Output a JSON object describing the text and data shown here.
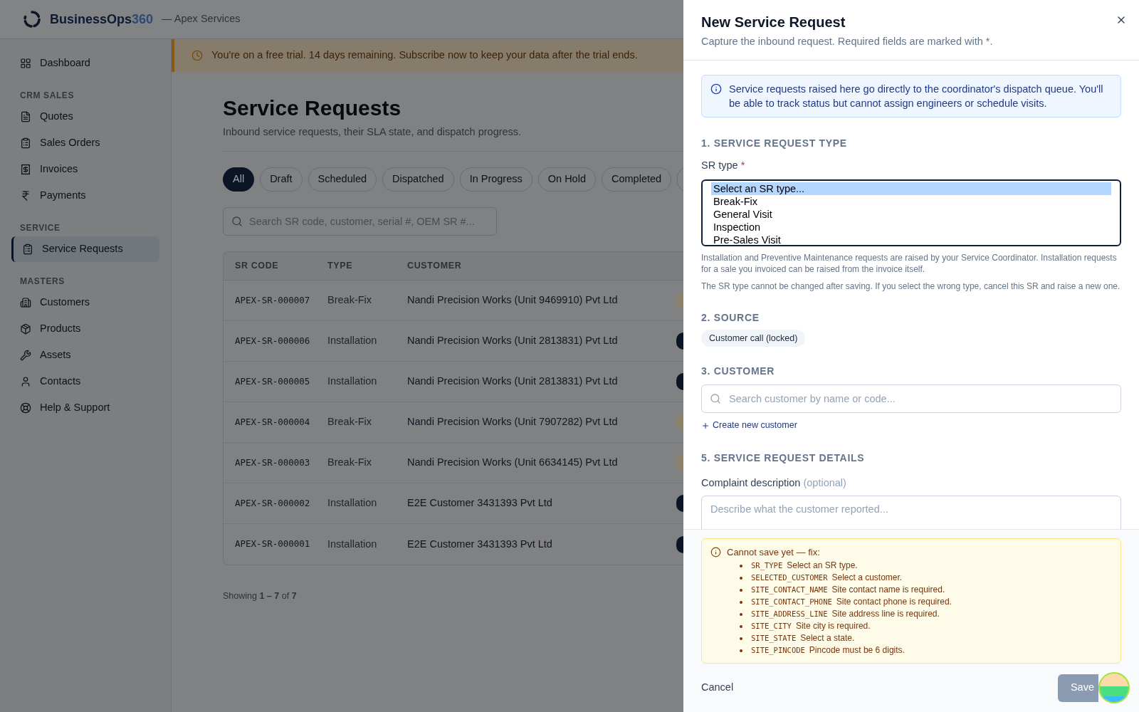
{
  "app": {
    "brand": "BusinessOps",
    "brand_suffix": "360",
    "org": "— Apex Services"
  },
  "sidebar": {
    "groups": [
      {
        "items": [
          {
            "label": "Dashboard",
            "selected": false
          }
        ]
      },
      {
        "heading": "CRM SALES",
        "items": [
          {
            "label": "Quotes",
            "selected": false
          },
          {
            "label": "Sales Orders",
            "selected": false
          },
          {
            "label": "Invoices",
            "selected": false
          },
          {
            "label": "Payments",
            "selected": false
          }
        ]
      },
      {
        "heading": "SERVICE",
        "items": [
          {
            "label": "Service Requests",
            "selected": true
          }
        ]
      },
      {
        "heading": "MASTERS",
        "items": [
          {
            "label": "Customers",
            "selected": false
          },
          {
            "label": "Products",
            "selected": false
          },
          {
            "label": "Assets",
            "selected": false
          },
          {
            "label": "Contacts",
            "selected": false
          },
          {
            "label": "Help & Support",
            "selected": false
          }
        ]
      }
    ]
  },
  "trial_banner": "You're on a free trial. 14 days remaining. Subscribe now to keep your data after the trial ends.",
  "page": {
    "title": "Service Requests",
    "subtitle": "Inbound service requests, their SLA state, and dispatch progress.",
    "filters": [
      {
        "label": "All",
        "selected": true
      },
      {
        "label": "Draft",
        "selected": false
      },
      {
        "label": "Scheduled",
        "selected": false
      },
      {
        "label": "Dispatched",
        "selected": false
      },
      {
        "label": "In Progress",
        "selected": false
      },
      {
        "label": "On Hold",
        "selected": false
      },
      {
        "label": "Completed",
        "selected": false
      },
      {
        "selected": false
      }
    ],
    "search_placeholder": "Search SR code, customer, serial #, OEM SR #...",
    "table": {
      "columns": [
        "SR CODE",
        "TYPE",
        "CUSTOMER"
      ],
      "rows": [
        {
          "code": "APEX-SR-000007",
          "type": "Break-Fix",
          "customer": "Nandi Precision Works (Unit 9469910) Pvt Ltd",
          "color": "#8a826a"
        },
        {
          "code": "APEX-SR-000006",
          "type": "Installation",
          "customer": "Nandi Precision Works (Unit 2813831) Pvt Ltd",
          "color": "#0b1526"
        },
        {
          "code": "APEX-SR-000005",
          "type": "Installation",
          "customer": "Nandi Precision Works (Unit 2813831) Pvt Ltd",
          "color": "#0b1526"
        },
        {
          "code": "APEX-SR-000004",
          "type": "Break-Fix",
          "customer": "Nandi Precision Works (Unit 7907282) Pvt Ltd",
          "color": "#8a826a"
        },
        {
          "code": "APEX-SR-000003",
          "type": "Break-Fix",
          "customer": "Nandi Precision Works (Unit 6634145) Pvt Ltd",
          "color": "#8a826a"
        },
        {
          "code": "APEX-SR-000002",
          "type": "Installation",
          "customer": "E2E Customer 3431393 Pvt Ltd",
          "color": "#0b1526"
        },
        {
          "code": "APEX-SR-000001",
          "type": "Installation",
          "customer": "E2E Customer 3431393 Pvt Ltd",
          "color": "#0b1526"
        }
      ]
    },
    "showing": "Showing **1 – 7** of **7**"
  },
  "drawer": {
    "title": "New Service Request",
    "subtitle": "Capture the inbound request. Required fields are marked with *.",
    "info": "Service requests raised here go directly to the coordinator's dispatch queue. You'll be able to track status but cannot assign engineers or schedule visits.",
    "sections": [
      {
        "heading": "1. SERVICE REQUEST TYPE",
        "label": "SR type",
        "required_mark": "*",
        "options": [
          {
            "label": "Select an SR type...",
            "selected": true
          },
          {
            "label": "Break-Fix",
            "selected": false
          },
          {
            "label": "General Visit",
            "selected": false
          },
          {
            "label": "Inspection",
            "selected": false
          },
          {
            "label": "Pre-Sales Visit",
            "selected": false
          }
        ],
        "notes": [
          "Installation and Preventive Maintenance requests are raised by your Service Coordinator. Installation requests for a sale you invoiced can be raised from the invoice itself.",
          "The SR type cannot be changed after saving. If you select the wrong type, cancel this SR and raise a new one."
        ]
      },
      {
        "heading": "2. SOURCE",
        "chip": "Customer call (locked)"
      },
      {
        "heading": "3. CUSTOMER",
        "placeholder": "Search customer by name or code...",
        "link": "Create new customer"
      },
      {
        "heading": "5. SERVICE REQUEST DETAILS",
        "label": "Complaint description",
        "hint": "(optional)",
        "placeholder": "Describe what the customer reported..."
      }
    ],
    "errors": {
      "title": "Cannot save yet — fix:",
      "items": [
        {
          "code": "SR_TYPE",
          "text": "Select an SR type."
        },
        {
          "code": "SELECTED_CUSTOMER",
          "text": "Select a customer."
        },
        {
          "code": "SITE_CONTACT_NAME",
          "text": "Site contact name is required."
        },
        {
          "code": "SITE_CONTACT_PHONE",
          "text": "Site contact phone is required."
        },
        {
          "code": "SITE_ADDRESS_LINE",
          "text": "Site address line is required."
        },
        {
          "code": "SITE_CITY",
          "text": "Site city is required."
        },
        {
          "code": "SITE_STATE",
          "text": "Select a state."
        },
        {
          "code": "SITE_PINCODE",
          "text": "Pincode must be 6 digits."
        }
      ]
    },
    "cancel": "Cancel",
    "save": "Save",
    "save_disabled": true
  }
}
